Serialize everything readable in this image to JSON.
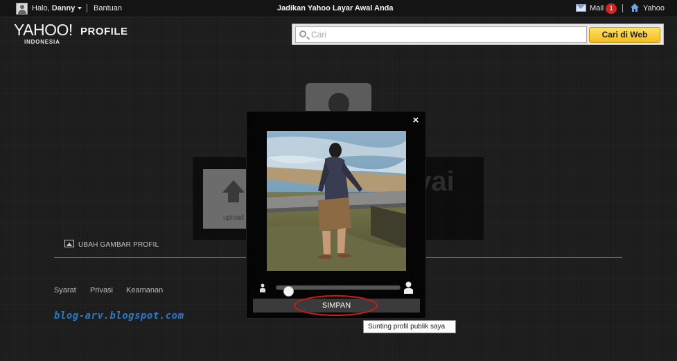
{
  "topbar": {
    "greeting_prefix": "Halo,",
    "user_name": "Danny",
    "help": "Bantuan",
    "center_promo": "Jadikan Yahoo Layar Awal Anda",
    "mail": "Mail",
    "mail_count": "1",
    "home": "Yahoo"
  },
  "brand": {
    "logo": "YAHOO!",
    "product": "PROFILE",
    "country": "INDONESIA"
  },
  "search": {
    "placeholder": "Cari",
    "button": "Cari di Web"
  },
  "profile_page": {
    "upload_tile_label": "upload",
    "name_fragment": "ivai",
    "change_photo": "UBAH GAMBAR PROFIL"
  },
  "footer": {
    "links": [
      "Syarat",
      "Privasi",
      "Keamanan"
    ],
    "watermark": "blog-arv.blogspot.com"
  },
  "modal": {
    "close": "×",
    "save_button": "SIMPAN",
    "zoom_level": 0.05
  },
  "tooltip": {
    "text": "Sunting profil publik saya"
  },
  "colors": {
    "accent_button": "#f3bd1c",
    "badge": "#d42323",
    "annotation_circle": "#e01515",
    "watermark": "#2a7ac8"
  },
  "icons": {
    "user_avatar": "user-avatar-icon",
    "mail": "envelope-icon",
    "home": "home-icon",
    "search": "magnifier-icon",
    "upload": "upload-arrow-icon",
    "change_photo": "picture-icon",
    "zoom_out": "person-small-icon",
    "zoom_in": "person-large-icon"
  }
}
